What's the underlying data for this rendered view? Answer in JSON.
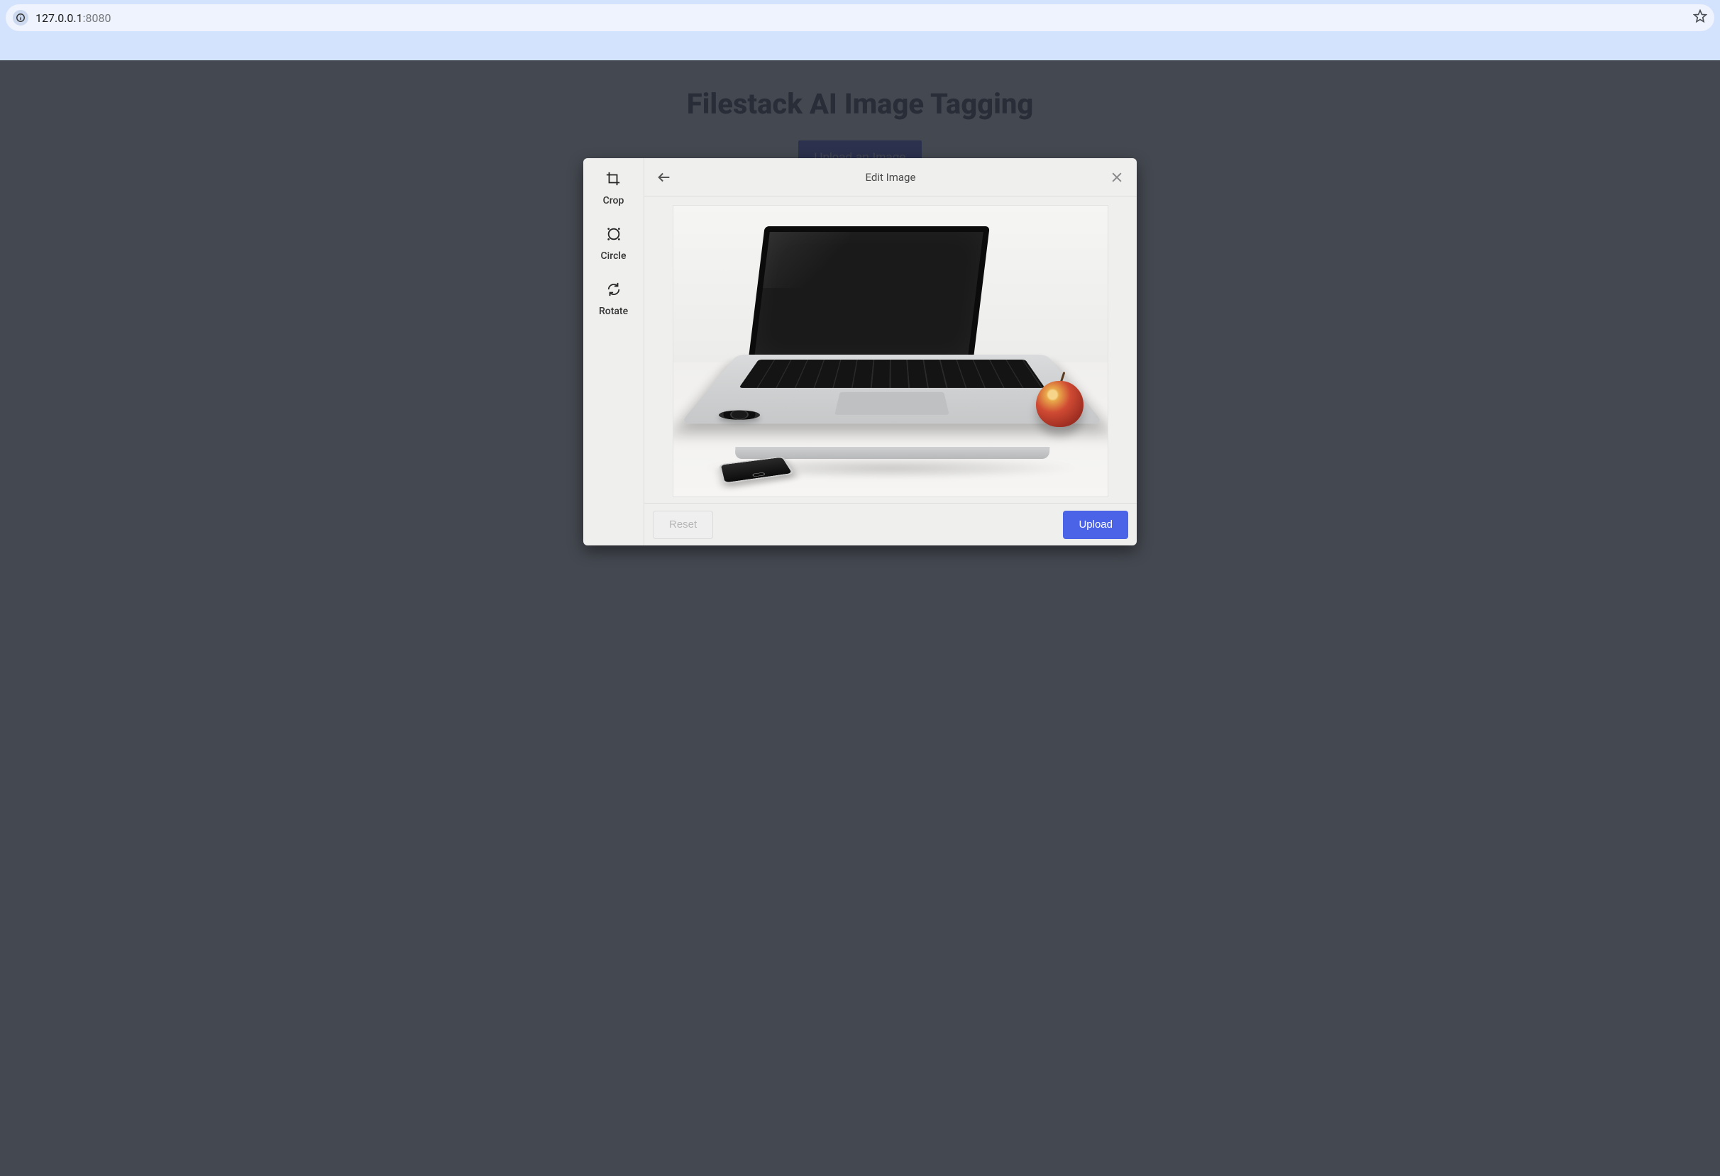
{
  "browser": {
    "url_host": "127.0.0.1",
    "url_port": ":8080"
  },
  "page": {
    "title": "Filestack AI Image Tagging",
    "upload_btn": "Upload an Image"
  },
  "modal": {
    "header": {
      "title": "Edit Image"
    },
    "tools": {
      "crop": "Crop",
      "circle": "Circle",
      "rotate": "Rotate"
    },
    "footer": {
      "reset": "Reset",
      "upload": "Upload"
    }
  }
}
